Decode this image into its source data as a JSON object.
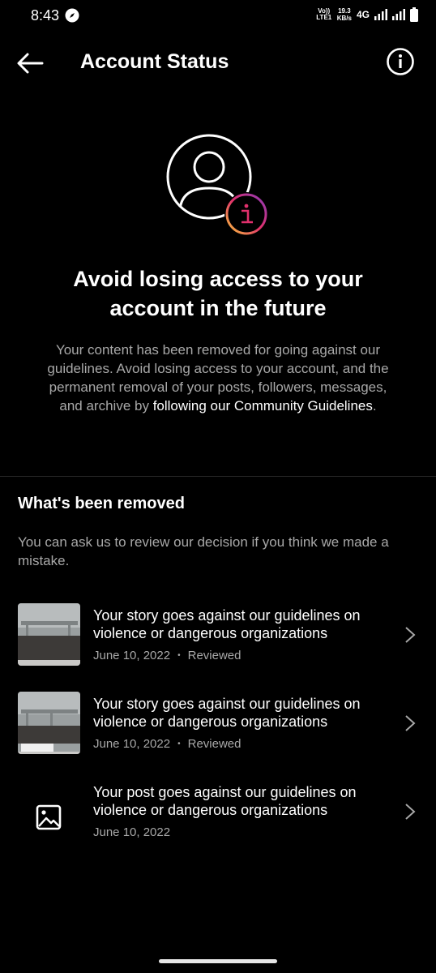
{
  "status_bar": {
    "time": "8:43",
    "volte_line1": "Vo))",
    "volte_line2": "LTE1",
    "speed_value": "19.3",
    "speed_unit": "KB/s",
    "network": "4G"
  },
  "header": {
    "title": "Account Status",
    "back_icon": "arrow-left-icon",
    "info_icon": "info-circle-icon"
  },
  "hero": {
    "icon": "profile-info-icon",
    "badge_color_start": "#f9c33b",
    "badge_color_mid": "#e1306c",
    "badge_color_end": "#8a3ab9",
    "headline": "Avoid losing access to your account in the future",
    "description_prefix": "Your content has been removed for going against our guidelines. Avoid losing access to your account, and the permanent removal of your posts, followers, messages, and archive by ",
    "description_link": "following our Community Guidelines",
    "description_suffix": "."
  },
  "removed_section": {
    "title": "What's been removed",
    "note": "You can ask us to review our decision if you think we made a mistake.",
    "items": [
      {
        "text": "Your story goes against our guidelines on violence or dangerous organizations",
        "date": "June 10, 2022",
        "status": "Reviewed",
        "thumb": "story-thumbnail"
      },
      {
        "text": "Your story goes against our guidelines on violence or dangerous organizations",
        "date": "June 10, 2022",
        "status": "Reviewed",
        "thumb": "story-thumbnail"
      },
      {
        "text": "Your post goes against our guidelines on violence or dangerous organizations",
        "date": "June 10, 2022",
        "thumb": "image-placeholder-icon"
      }
    ]
  },
  "colors": {
    "background": "#000000",
    "text_primary": "#ffffff",
    "text_secondary": "#a8a8a8",
    "divider": "#262626"
  }
}
